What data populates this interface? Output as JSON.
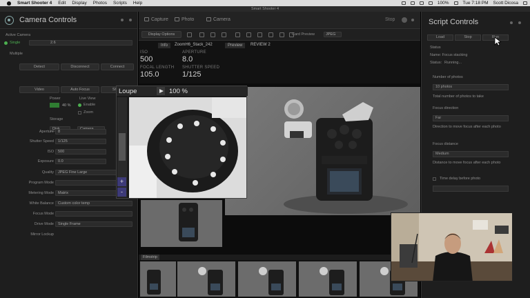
{
  "os_menubar": {
    "app_name": "Smart Shooter 4",
    "menus": [
      "Edit",
      "Display",
      "Photos",
      "Scripts",
      "Help"
    ],
    "battery": "100%",
    "clock": "Tue 7:18 PM",
    "user": "Scott Dicosa"
  },
  "window": {
    "title": "Smart Shooter 4"
  },
  "left_panel": {
    "title": "Camera Controls",
    "active_camera_label": "Active Camera",
    "single_label": "Single",
    "single_value": "2.6",
    "multiple_label": "Multiple",
    "buttons_row1": [
      "Detect",
      "Disconnect",
      "Connect"
    ],
    "buttons_row2": [
      "Video",
      "Auto Focus",
      "Shoot"
    ],
    "power_label": "Power",
    "power_value": "40 %",
    "live_view_label": "Live View",
    "enable_label": "Enable",
    "zoom_label": "Zoom",
    "storage_label": "Storage",
    "storage_value1": "Disk",
    "storage_value2": "Camera",
    "settings": [
      {
        "label": "Aperture",
        "value": "8"
      },
      {
        "label": "Shutter Speed",
        "value": "1/125"
      },
      {
        "label": "ISO",
        "value": "500"
      },
      {
        "label": "Exposure",
        "value": "0.0"
      },
      {
        "label": "Quality",
        "value": "JPEG Fine Large"
      },
      {
        "label": "Program Mode",
        "value": ""
      },
      {
        "label": "Metering Mode",
        "value": "Matrix"
      },
      {
        "label": "White Balance",
        "value": "Custom color temp"
      },
      {
        "label": "Focus Mode",
        "value": ""
      },
      {
        "label": "Drive Mode",
        "value": "Single Frame"
      },
      {
        "label": "Mirror Lockup",
        "value": ""
      }
    ]
  },
  "tabs": {
    "capture": "Capture",
    "photo": "Photo",
    "camera": "Camera",
    "stop": "Stop"
  },
  "toolbar": {
    "display_options": "Display Options",
    "card_preview": "Card Preview",
    "format": "JPEG"
  },
  "info_strip": {
    "info_tab": "Info",
    "filename": "ZoomH6_Stack_242",
    "preview_tab": "Preview",
    "review_tab": "REVIEW 2",
    "iso_label": "ISO",
    "iso_value": "500",
    "aperture_label": "APERTURE",
    "aperture_value": "8.0",
    "focal_label": "FOCAL LENGTH",
    "focal_value": "105.0",
    "shutter_label": "SHUTTER SPEED",
    "shutter_value": "1/125"
  },
  "loupe": {
    "title": "Loupe",
    "zoom": "100 %",
    "plus": "+",
    "minus": "-"
  },
  "filmstrip": {
    "label": "Filmstrip"
  },
  "right_panel": {
    "title": "Script Controls",
    "tabs": [
      "Load",
      "Stop",
      "Run"
    ],
    "status_label": "Status",
    "name_line": "Name: Focus stacking",
    "status_prefix": "Status:",
    "status_value": "Running...",
    "num_photos_label": "Number of photos",
    "num_photos_value": "10 photos",
    "num_photos_hint": "Total number of photos to take",
    "focus_direction_label": "Focus direction",
    "focus_direction_value": "Far",
    "focus_direction_hint": "Direction to move focus after each photo",
    "focus_distance_label": "Focus distance",
    "focus_distance_value": "Medium",
    "focus_distance_hint": "Distance to move focus after each photo",
    "time_delay_label": "Time delay before photo"
  },
  "colors": {
    "accent_green": "#4caf50",
    "zoom_button": "#3d3a78",
    "panel_bg": "#1e1e1e"
  }
}
